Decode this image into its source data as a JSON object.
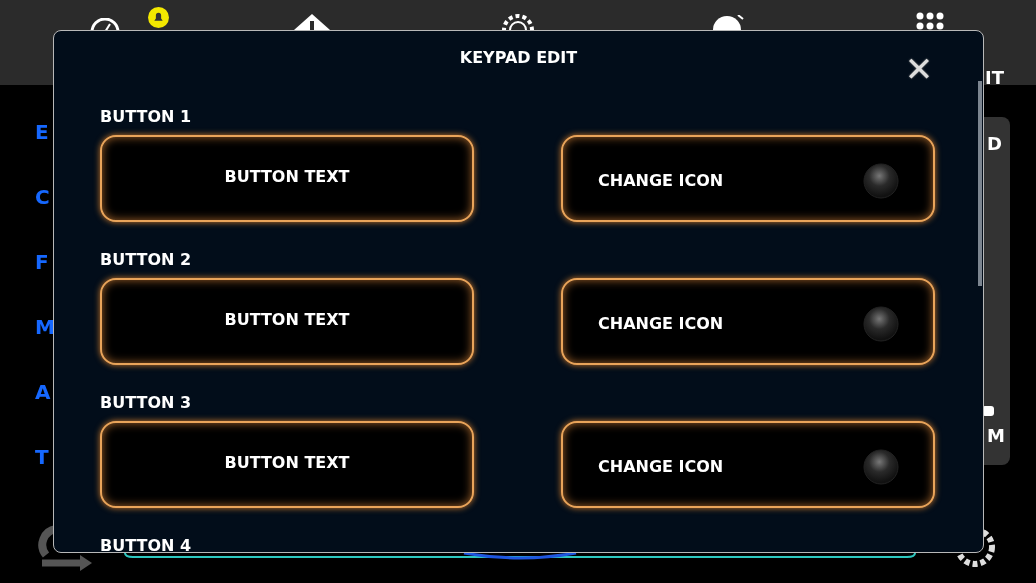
{
  "background": {
    "side_letters": [
      "E",
      "C",
      "F",
      "M",
      "A",
      "T"
    ],
    "header_text": "IT",
    "panel_texts": [
      "D",
      "M"
    ]
  },
  "modal": {
    "title": "KEYPAD EDIT",
    "close": "✕",
    "rows": [
      {
        "label": "BUTTON 1",
        "text_button": "BUTTON TEXT",
        "icon_button": "CHANGE ICON"
      },
      {
        "label": "BUTTON 2",
        "text_button": "BUTTON TEXT",
        "icon_button": "CHANGE ICON"
      },
      {
        "label": "BUTTON 3",
        "text_button": "BUTTON TEXT",
        "icon_button": "CHANGE ICON"
      },
      {
        "label": "BUTTON 4"
      }
    ]
  }
}
